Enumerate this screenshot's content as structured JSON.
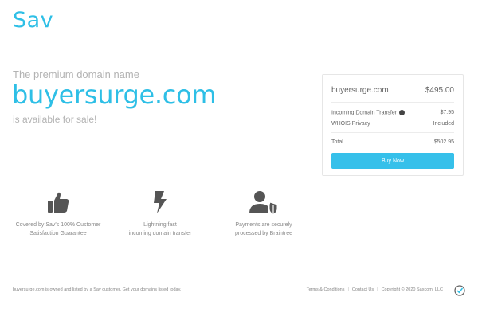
{
  "brand": {
    "logo_text": "Sav",
    "accent": "#2ebfe6"
  },
  "hero": {
    "lead": "The premium domain name",
    "domain": "buyersurge.com",
    "tail": "is available for sale!"
  },
  "card": {
    "domain": "buyersurge.com",
    "price": "$495.00",
    "transfer_label": "Incoming Domain Transfer",
    "transfer_price": "$7.95",
    "whois_label": "WHOIS Privacy",
    "whois_value": "Included",
    "total_label": "Total",
    "total_value": "$502.95",
    "buy_label": "Buy Now"
  },
  "features": [
    {
      "icon": "thumbs-up-icon",
      "line1": "Covered by Sav's 100% Customer",
      "line2": "Satisfaction Guarantee"
    },
    {
      "icon": "lightning-bolt-icon",
      "line1": "Lightning fast",
      "line2": "incoming domain transfer"
    },
    {
      "icon": "user-shield-icon",
      "line1": "Payments are securely",
      "line2": "processed by Braintree"
    }
  ],
  "footer": {
    "note": "buyersurge.com is owned and listed by a Sav customer. Get your domains listed today.",
    "terms": "Terms & Conditions",
    "contact": "Contact Us",
    "copyright": "Copyright © 2020 Saxcom, LLC"
  }
}
